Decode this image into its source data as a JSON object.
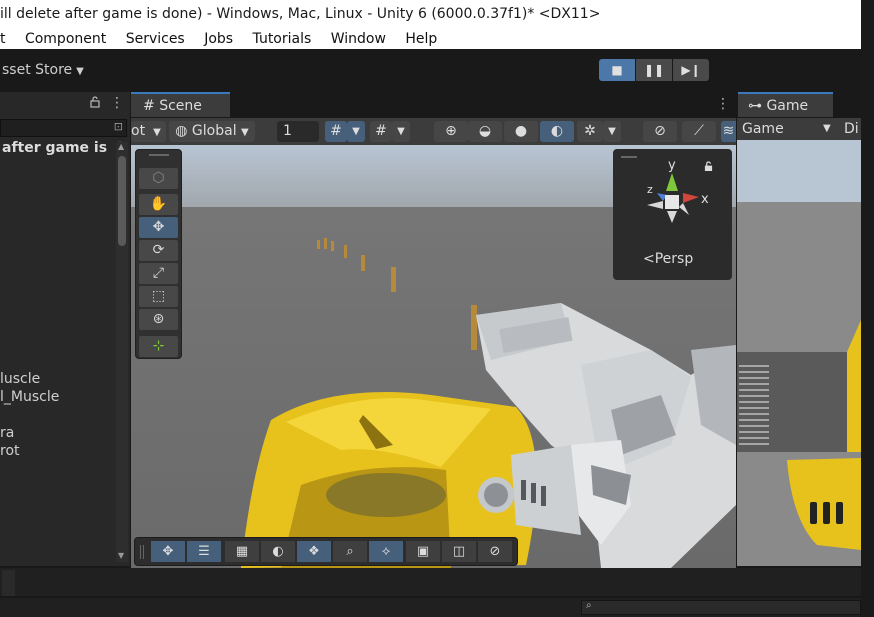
{
  "window": {
    "title": "ill delete after game is done) - Windows, Mac, Linux - Unity 6 (6000.0.37f1)* <DX11>"
  },
  "menu": [
    "t",
    "Component",
    "Services",
    "Jobs",
    "Tutorials",
    "Window",
    "Help"
  ],
  "toolbar": {
    "asset_store": "sset Store",
    "play_icons": [
      "stop-icon",
      "pause-icon",
      "step-icon"
    ]
  },
  "hierarchy": {
    "root": "after game is",
    "root_more": "⋮",
    "items": [
      "luscle",
      "l_Muscle",
      "",
      "ra",
      "rot"
    ]
  },
  "scene": {
    "tab_label": "Scene",
    "pivot_label": "ot",
    "space_label": "Global",
    "grid_value": "1",
    "persp_label": "Persp",
    "axis_y": "y",
    "axis_x": "x",
    "axis_z": "z"
  },
  "game": {
    "tab_label": "Game",
    "display_label": "Game",
    "extra_label": "Di"
  },
  "colors": {
    "accent": "#3a79bb",
    "active_button": "#46607c",
    "car_yellow": "#e7c21c",
    "axis_y": "#7fc73a",
    "axis_x": "#d0463b",
    "axis_z": "#4d7fd4"
  }
}
